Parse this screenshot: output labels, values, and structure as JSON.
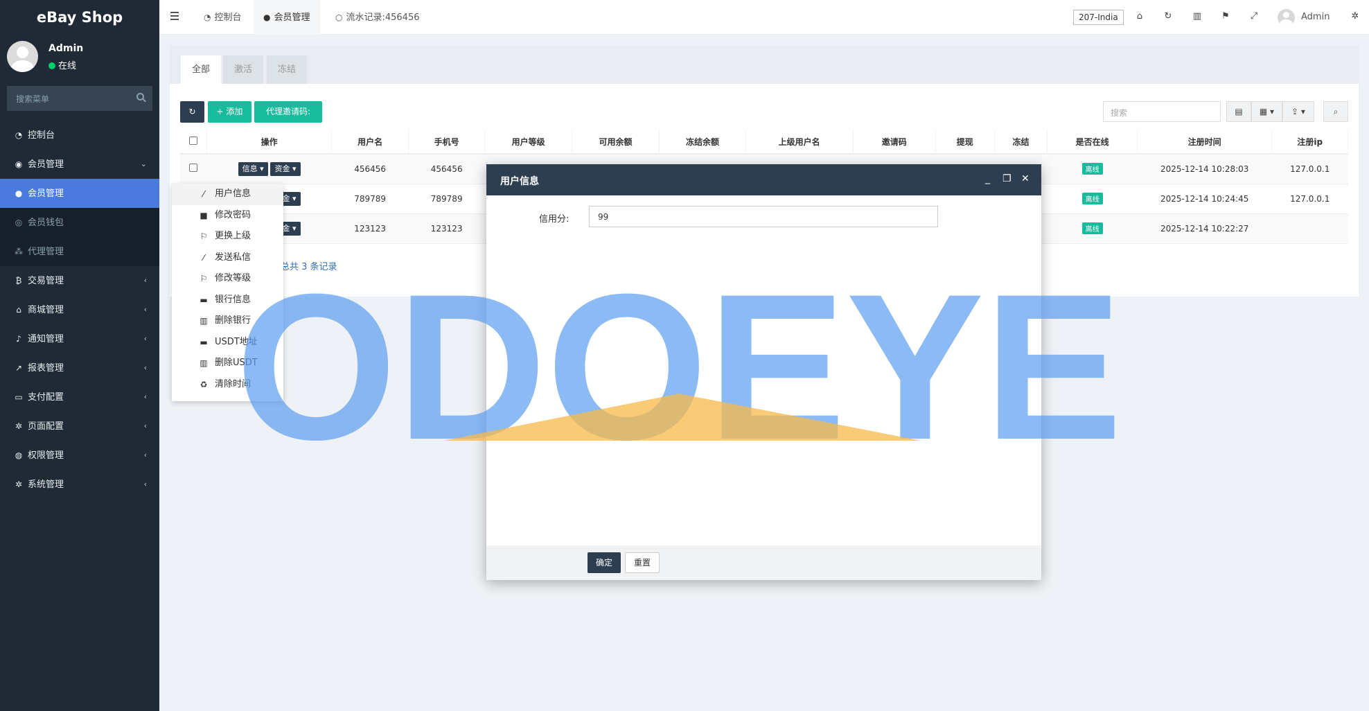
{
  "sidebar": {
    "brand": "eBay Shop",
    "user": {
      "name": "Admin",
      "status": "在线"
    },
    "search_placeholder": "搜索菜单",
    "items": [
      {
        "label": "控制台",
        "icon": "dashboard-icon"
      },
      {
        "label": "会员管理",
        "icon": "user-circle-icon"
      },
      {
        "label": "会员管理",
        "icon": "user-icon"
      },
      {
        "label": "会员钱包",
        "icon": "wallet-icon"
      },
      {
        "label": "代理管理",
        "icon": "sitemap-icon"
      },
      {
        "label": "交易管理",
        "icon": "bitcoin-icon"
      },
      {
        "label": "商城管理",
        "icon": "home-icon"
      },
      {
        "label": "通知管理",
        "icon": "bell-icon"
      },
      {
        "label": "报表管理",
        "icon": "chart-icon"
      },
      {
        "label": "支付配置",
        "icon": "card-icon"
      },
      {
        "label": "页面配置",
        "icon": "gear-icon"
      },
      {
        "label": "权限管理",
        "icon": "users-icon"
      },
      {
        "label": "系统管理",
        "icon": "cogs-icon"
      }
    ]
  },
  "topbar": {
    "tabs": [
      "控制台",
      "会员管理",
      "流水记录:456456"
    ],
    "region": "207-India",
    "admin": "Admin"
  },
  "panel": {
    "tabs": [
      "全部",
      "激活",
      "冻结"
    ],
    "add_label": "添加",
    "invite_label": "代理邀请码:",
    "search_placeholder": "搜索",
    "columns": [
      "操作",
      "用户名",
      "手机号",
      "用户等级",
      "可用余额",
      "冻结余额",
      "上级用户名",
      "邀请码",
      "提现",
      "冻结",
      "是否在线",
      "注册时间",
      "注册ip"
    ],
    "rows": [
      {
        "username": "456456",
        "phone": "456456",
        "online": "离线",
        "time": "2025-12-14 10:28:03",
        "ip": "127.0.0.1"
      },
      {
        "username": "789789",
        "phone": "789789",
        "online": "离线",
        "time": "2025-12-14 10:24:45",
        "ip": "127.0.0.1"
      },
      {
        "username": "123123",
        "phone": "123123",
        "online": "离线",
        "time": "2025-12-14 10:22:27",
        "ip": ""
      }
    ],
    "info_btn": "信息",
    "fund_btn": "资金",
    "total_text": "总共 3 条记录"
  },
  "dropdown": {
    "items": [
      {
        "label": "用户信息",
        "icon": "magic-wand-icon"
      },
      {
        "label": "修改密码",
        "icon": "lock-icon"
      },
      {
        "label": "更换上级",
        "icon": "flag-icon"
      },
      {
        "label": "发送私信",
        "icon": "magic-wand-icon"
      },
      {
        "label": "修改等级",
        "icon": "flag-icon"
      },
      {
        "label": "银行信息",
        "icon": "credit-card-icon"
      },
      {
        "label": "删除银行",
        "icon": "trash-icon"
      },
      {
        "label": "USDT地址",
        "icon": "credit-card-icon"
      },
      {
        "label": "删除USDT",
        "icon": "trash-icon"
      },
      {
        "label": "清除时间",
        "icon": "recycle-icon"
      }
    ]
  },
  "modal": {
    "title": "用户信息",
    "field_label": "信用分:",
    "field_value": "99",
    "ok": "确定",
    "reset": "重置"
  },
  "watermark": {
    "text": "ODOEYE",
    "colors": {
      "text": "#5b9cf0",
      "roof": "#f8b94a"
    }
  }
}
